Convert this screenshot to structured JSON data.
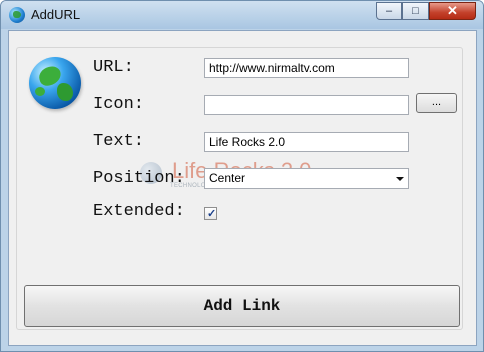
{
  "window": {
    "title": "AddURL",
    "controls": {
      "minimize": "–",
      "maximize": "□",
      "close": "✕"
    }
  },
  "form": {
    "url": {
      "label": "URL:",
      "value": "http://www.nirmaltv.com"
    },
    "icon": {
      "label": "Icon:",
      "value": "",
      "browse_label": "..."
    },
    "text": {
      "label": "Text:",
      "value": "Life Rocks 2.0"
    },
    "position": {
      "label": "Position:",
      "selected": "Center"
    },
    "extended": {
      "label": "Extended:",
      "checked": true
    }
  },
  "actions": {
    "add_link_label": "Add Link"
  },
  "watermark": {
    "name": "Life Rocks 2.0",
    "tagline": "TECHNOLOGY | WINDOWS | MOBILES | SOFTWARES | TRICKS | TIPS"
  },
  "icons": {
    "app": "globe-icon",
    "checkbox": "checkmark-icon",
    "dropdown": "chevron-down-icon"
  }
}
